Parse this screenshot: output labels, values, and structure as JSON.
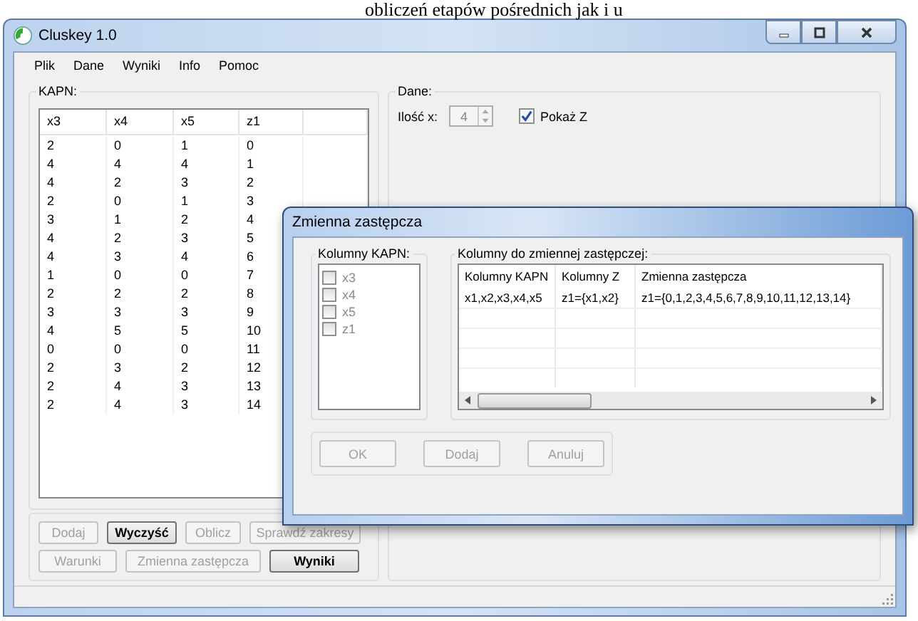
{
  "background_text": "obliczeń etapów pośrednich jak i u",
  "window": {
    "title": "Cluskey 1.0"
  },
  "menu": [
    "Plik",
    "Dane",
    "Wyniki",
    "Info",
    "Pomoc"
  ],
  "kapn": {
    "label": "KAPN:",
    "columns": [
      "x3",
      "x4",
      "x5",
      "z1"
    ],
    "rows": [
      [
        "2",
        "0",
        "1",
        "0"
      ],
      [
        "4",
        "4",
        "4",
        "1"
      ],
      [
        "4",
        "2",
        "3",
        "2"
      ],
      [
        "2",
        "0",
        "1",
        "3"
      ],
      [
        "3",
        "1",
        "2",
        "4"
      ],
      [
        "4",
        "2",
        "3",
        "5"
      ],
      [
        "4",
        "3",
        "4",
        "6"
      ],
      [
        "1",
        "0",
        "0",
        "7"
      ],
      [
        "2",
        "2",
        "2",
        "8"
      ],
      [
        "3",
        "3",
        "3",
        "9"
      ],
      [
        "4",
        "5",
        "5",
        "10"
      ],
      [
        "0",
        "0",
        "0",
        "11"
      ],
      [
        "2",
        "3",
        "2",
        "12"
      ],
      [
        "2",
        "4",
        "3",
        "13"
      ],
      [
        "2",
        "4",
        "3",
        "14"
      ]
    ]
  },
  "dane": {
    "label": "Dane:",
    "count_label": "Ilość x:",
    "count_value": "4",
    "count_disabled": true,
    "show_z": {
      "label": "Pokaż Z",
      "checked": true
    }
  },
  "button_rows": [
    [
      {
        "label": "Dodaj",
        "disabled": true
      },
      {
        "label": "Wyczyść",
        "disabled": false
      },
      {
        "label": "Oblicz",
        "disabled": true
      },
      {
        "label": "Sprawdź zakresy",
        "disabled": true
      }
    ],
    [
      {
        "label": "Warunki",
        "disabled": true
      },
      {
        "label": "Zmienna zastępcza",
        "disabled": true
      },
      {
        "label": "Wyniki",
        "disabled": false
      }
    ]
  ],
  "dialog": {
    "title": "Zmienna zastępcza",
    "kapn_columns": {
      "label": "Kolumny KAPN:",
      "items": [
        {
          "label": "x3",
          "checked": false,
          "disabled": true
        },
        {
          "label": "x4",
          "checked": false,
          "disabled": true
        },
        {
          "label": "x5",
          "checked": false,
          "disabled": true
        },
        {
          "label": "z1",
          "checked": false,
          "disabled": true
        }
      ]
    },
    "grid": {
      "label": "Kolumny do zmiennej zastępczej:",
      "columns": [
        "Kolumny KAPN",
        "Kolumny Z",
        "Zmienna zastępcza"
      ],
      "rows": [
        [
          "x1,x2,x3,x4,x5",
          "z1={x1,x2}",
          "z1={0,1,2,3,4,5,6,7,8,9,10,11,12,13,14}"
        ]
      ]
    },
    "buttons": [
      {
        "label": "OK",
        "disabled": true
      },
      {
        "label": "Dodaj",
        "disabled": true
      },
      {
        "label": "Anuluj",
        "disabled": true
      }
    ]
  }
}
